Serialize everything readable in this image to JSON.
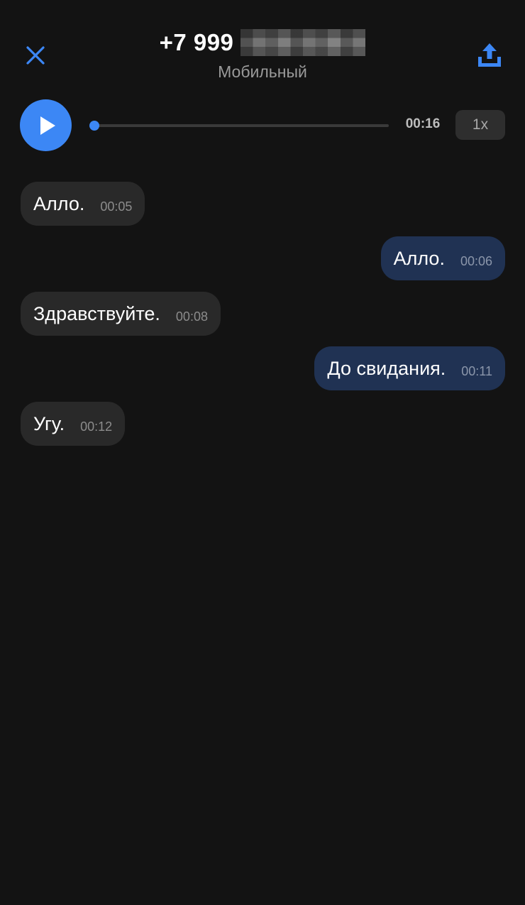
{
  "header": {
    "close_icon": "close-icon",
    "share_icon": "upload-share-icon",
    "phone_number_visible": "+7 999",
    "phone_type": "Мобильный"
  },
  "player": {
    "play_icon": "play-icon",
    "progress": 0.0,
    "duration": "00:16",
    "speed": "1x"
  },
  "colors": {
    "background": "#131313",
    "accent": "#3c87f5",
    "incoming_bubble": "#292929",
    "outgoing_bubble": "#203253"
  },
  "messages": [
    {
      "side": "in",
      "text": "Алло.",
      "time": "00:05"
    },
    {
      "side": "out",
      "text": "Алло.",
      "time": "00:06"
    },
    {
      "side": "in",
      "text": "Здравствуйте.",
      "time": "00:08"
    },
    {
      "side": "out",
      "text": "До свидания.",
      "time": "00:11"
    },
    {
      "side": "in",
      "text": "Угу.",
      "time": "00:12"
    }
  ]
}
